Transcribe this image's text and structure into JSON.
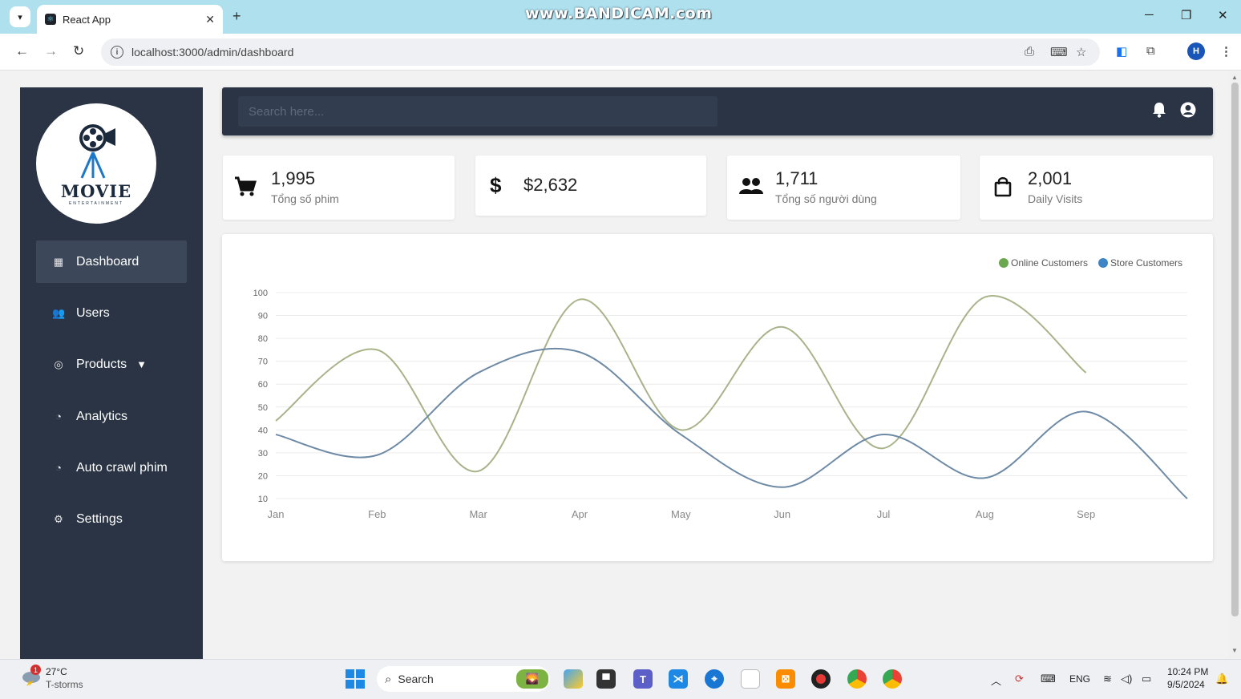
{
  "browser": {
    "tab_title": "React App",
    "tab_close": "✕",
    "new_tab": "+",
    "watermark": "www.BANDICAM.com",
    "url": "localhost:3000/admin/dashboard",
    "profile_initial": "H"
  },
  "sidebar": {
    "logo_text": "MOVIE",
    "logo_subtext": "ENTERTAINMENT",
    "items": [
      {
        "label": "Dashboard",
        "icon": "dashboard-icon",
        "active": true
      },
      {
        "label": "Users",
        "icon": "users-icon"
      },
      {
        "label": "Products",
        "icon": "products-icon",
        "has_dropdown": true
      },
      {
        "label": "Analytics",
        "icon": "analytics-icon"
      },
      {
        "label": "Auto crawl phim",
        "icon": "crawl-icon"
      },
      {
        "label": "Settings",
        "icon": "settings-icon"
      }
    ]
  },
  "topbar": {
    "search_placeholder": "Search here...",
    "icons": [
      "bell-icon",
      "user-circle-icon"
    ]
  },
  "stats": [
    {
      "value": "1,995",
      "label": "Tổng số phim",
      "icon": "cart-icon"
    },
    {
      "value": "$2,632",
      "label": "",
      "icon": "dollar-icon"
    },
    {
      "value": "1,711",
      "label": "Tổng số người dùng",
      "icon": "users-icon"
    },
    {
      "value": "2,001",
      "label": "Daily Visits",
      "icon": "shopping-bag-icon"
    }
  ],
  "chart_data": {
    "type": "line",
    "categories": [
      "Jan",
      "Feb",
      "Mar",
      "Apr",
      "May",
      "Jun",
      "Jul",
      "Aug",
      "Sep"
    ],
    "x": [
      "Jan",
      "Feb",
      "Mar",
      "Apr",
      "May",
      "Jun",
      "Jul",
      "Aug",
      "Sep",
      ""
    ],
    "series": [
      {
        "name": "Online Customers",
        "color": "#6aa84f",
        "values": [
          44,
          75,
          22,
          97,
          40,
          85,
          32,
          98,
          65
        ]
      },
      {
        "name": "Store Customers",
        "color": "#3d85c6",
        "values": [
          38,
          29,
          65,
          74,
          38,
          15,
          38,
          19,
          48,
          10
        ]
      }
    ],
    "yticks": [
      10,
      20,
      30,
      40,
      50,
      60,
      70,
      80,
      90,
      100
    ],
    "ylim": [
      10,
      100
    ],
    "legend": "top-right",
    "grid": true,
    "curve": "smooth"
  },
  "taskbar": {
    "weather_temp": "27°C",
    "weather_desc": "T-storms",
    "weather_badge": "1",
    "search_label": "Search",
    "lang": "ENG",
    "time": "10:24 PM",
    "date": "9/5/2024"
  }
}
